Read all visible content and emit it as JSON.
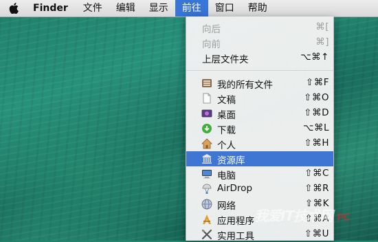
{
  "menubar": {
    "app_name": "Finder",
    "items": [
      "文件",
      "编辑",
      "显示",
      "前往",
      "窗口",
      "帮助"
    ],
    "active": "前往"
  },
  "go_menu": {
    "items": [
      {
        "label": "向后",
        "shortcut": "⌘[",
        "enabled": false,
        "icon": null
      },
      {
        "label": "向前",
        "shortcut": "⌘]",
        "enabled": false,
        "icon": null
      },
      {
        "label": "上层文件夹",
        "shortcut": "⌥⌘↑",
        "enabled": true,
        "icon": null
      },
      {
        "label": "我的所有文件",
        "shortcut": "⇧⌘F",
        "enabled": true,
        "icon": "all-files-icon"
      },
      {
        "label": "文稿",
        "shortcut": "⇧⌘O",
        "enabled": true,
        "icon": "documents-icon"
      },
      {
        "label": "桌面",
        "shortcut": "⇧⌘D",
        "enabled": true,
        "icon": "desktop-icon"
      },
      {
        "label": "下载",
        "shortcut": "⌥⌘L",
        "enabled": true,
        "icon": "downloads-icon"
      },
      {
        "label": "个人",
        "shortcut": "⇧⌘H",
        "enabled": true,
        "icon": "home-icon"
      },
      {
        "label": "资源库",
        "shortcut": "",
        "enabled": true,
        "icon": "library-icon",
        "selected": true
      },
      {
        "label": "电脑",
        "shortcut": "⇧⌘C",
        "enabled": true,
        "icon": "computer-icon"
      },
      {
        "label": "AirDrop",
        "shortcut": "⇧⌘R",
        "enabled": true,
        "icon": "airdrop-icon"
      },
      {
        "label": "网络",
        "shortcut": "⇧⌘K",
        "enabled": true,
        "icon": "network-icon"
      },
      {
        "label": "应用程序",
        "shortcut": "⇧⌘A",
        "enabled": true,
        "icon": "applications-icon"
      },
      {
        "label": "实用工具",
        "shortcut": "⇧⌘U",
        "enabled": true,
        "icon": "utilities-icon"
      }
    ]
  },
  "watermark": {
    "text": "我爱IT技术网",
    "sub": "PC"
  },
  "colors": {
    "selection": "#3f76d4",
    "menubar_active": "#3875d7"
  }
}
